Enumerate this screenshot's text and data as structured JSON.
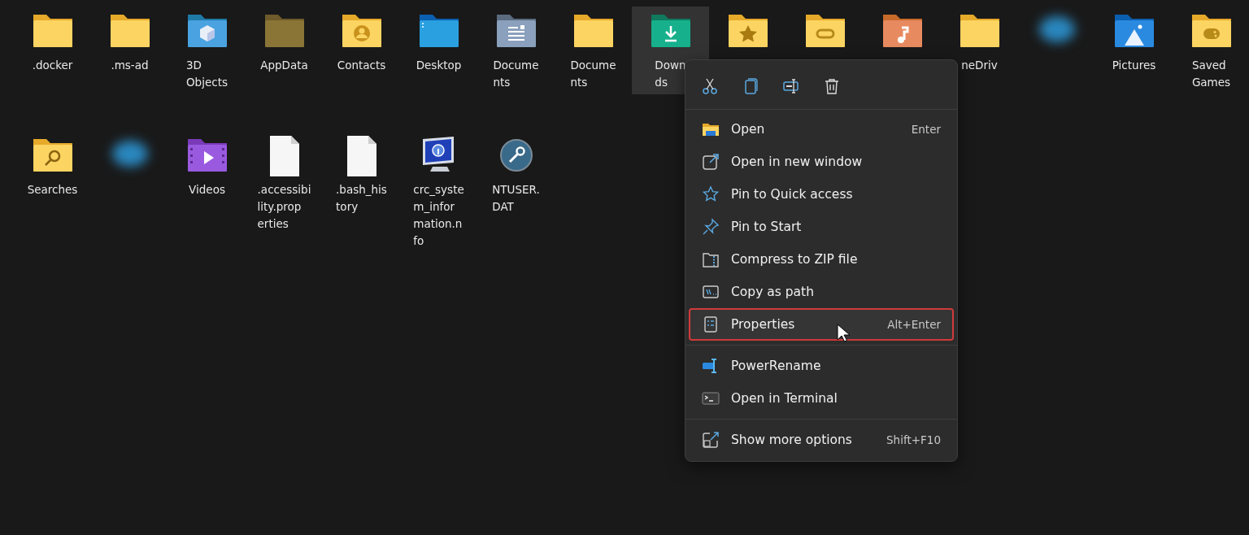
{
  "items": [
    {
      "kind": "folder",
      "label": [
        ".docker"
      ],
      "selected": false
    },
    {
      "kind": "folder",
      "label": [
        ".ms-ad"
      ],
      "selected": false
    },
    {
      "kind": "objects3d",
      "label": [
        "3D",
        "Objects"
      ],
      "selected": false
    },
    {
      "kind": "appdata",
      "label": [
        "AppData"
      ],
      "selected": false
    },
    {
      "kind": "contacts",
      "label": [
        "Contacts"
      ],
      "selected": false
    },
    {
      "kind": "desktop",
      "label": [
        "Desktop"
      ],
      "selected": false
    },
    {
      "kind": "documents",
      "label": [
        "Docume",
        "nts"
      ],
      "selected": false
    },
    {
      "kind": "folder",
      "label": [
        "Docume",
        "nts"
      ],
      "selected": false
    },
    {
      "kind": "downloads",
      "label": [
        "Down",
        "ds"
      ],
      "selected": true
    },
    {
      "kind": "favorites",
      "selected": false
    },
    {
      "kind": "links",
      "selected": false
    },
    {
      "kind": "music",
      "selected": false
    },
    {
      "kind": "folder",
      "label": [
        "neDriv"
      ],
      "selected": false
    },
    {
      "kind": "blurred",
      "selected": false
    },
    {
      "kind": "pictures",
      "label": [
        "Pictures"
      ],
      "selected": false
    },
    {
      "kind": "games",
      "label": [
        "Saved",
        "Games"
      ],
      "selected": false
    },
    {
      "kind": "searches",
      "label": [
        "Searches"
      ],
      "selected": false
    },
    {
      "kind": "blurred",
      "selected": false
    },
    {
      "kind": "videos",
      "label": [
        "Videos"
      ],
      "selected": false
    },
    {
      "kind": "file",
      "label": [
        ".accessibi",
        "lity.prop",
        "erties"
      ],
      "selected": false
    },
    {
      "kind": "file",
      "label": [
        ".bash_his",
        "tory"
      ],
      "selected": false
    },
    {
      "kind": "sysinfo",
      "label": [
        "crc_syste",
        "m_infor",
        "mation.n",
        "fo"
      ],
      "selected": false
    },
    {
      "kind": "tool",
      "label": [
        "NTUSER.",
        "DAT"
      ],
      "selected": false
    }
  ],
  "context_menu": {
    "toolbar": [
      {
        "kind": "cut"
      },
      {
        "kind": "copy"
      },
      {
        "kind": "rename"
      },
      {
        "kind": "delete"
      }
    ],
    "groups": [
      [
        {
          "kind": "open",
          "label": "Open",
          "shortcut": "Enter",
          "highlighted": false
        },
        {
          "kind": "newwindow",
          "label": "Open in new window",
          "highlighted": false
        },
        {
          "kind": "star",
          "label": "Pin to Quick access",
          "highlighted": false
        },
        {
          "kind": "pin",
          "label": "Pin to Start",
          "highlighted": false
        },
        {
          "kind": "zip",
          "label": "Compress to ZIP file",
          "highlighted": false
        },
        {
          "kind": "path",
          "label": "Copy as path",
          "highlighted": false
        },
        {
          "kind": "properties",
          "label": "Properties",
          "shortcut": "Alt+Enter",
          "highlighted": true
        }
      ],
      [
        {
          "kind": "powerrename",
          "label": "PowerRename",
          "highlighted": false
        },
        {
          "kind": "terminal",
          "label": "Open in Terminal",
          "highlighted": false
        }
      ],
      [
        {
          "kind": "more",
          "label": "Show more options",
          "shortcut": "Shift+F10",
          "highlighted": false
        }
      ]
    ]
  }
}
